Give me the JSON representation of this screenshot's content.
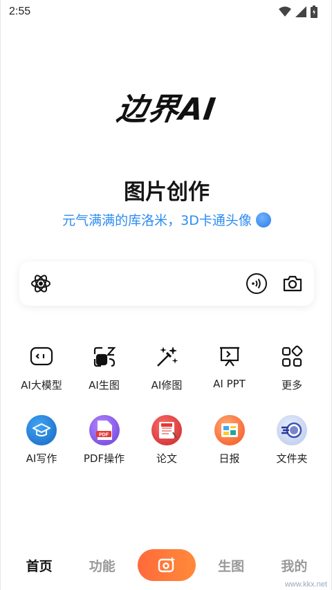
{
  "status": {
    "time": "2:55"
  },
  "logo": {
    "text": "边界AI"
  },
  "hero": {
    "title": "图片创作",
    "subtitle": "元气满满的库洛米，3D卡通头像"
  },
  "tools": [
    {
      "label": "AI大模型",
      "icon": "chat-box-icon"
    },
    {
      "label": "AI生图",
      "icon": "image-gen-icon"
    },
    {
      "label": "AI修图",
      "icon": "magic-wand-icon"
    },
    {
      "label": "AI PPT",
      "icon": "presentation-icon"
    },
    {
      "label": "更多",
      "icon": "grid-more-icon"
    }
  ],
  "apps": [
    {
      "label": "AI写作",
      "icon": "graduation-cap-icon",
      "color": "#2196f3"
    },
    {
      "label": "PDF操作",
      "icon": "pdf-icon",
      "color": "#8a5cf6"
    },
    {
      "label": "论文",
      "icon": "paper-icon",
      "color": "#e53935"
    },
    {
      "label": "日报",
      "icon": "report-icon",
      "color": "#ff7043"
    },
    {
      "label": "文件夹",
      "icon": "folder-icon",
      "color": "#3f51b5"
    }
  ],
  "tabbar": {
    "home": "首页",
    "features": "功能",
    "generate": "生图",
    "mine": "我的"
  },
  "watermark": "www.kkx.net",
  "colors": {
    "accent": "#2c8df0",
    "create": "#ff6a3a"
  }
}
